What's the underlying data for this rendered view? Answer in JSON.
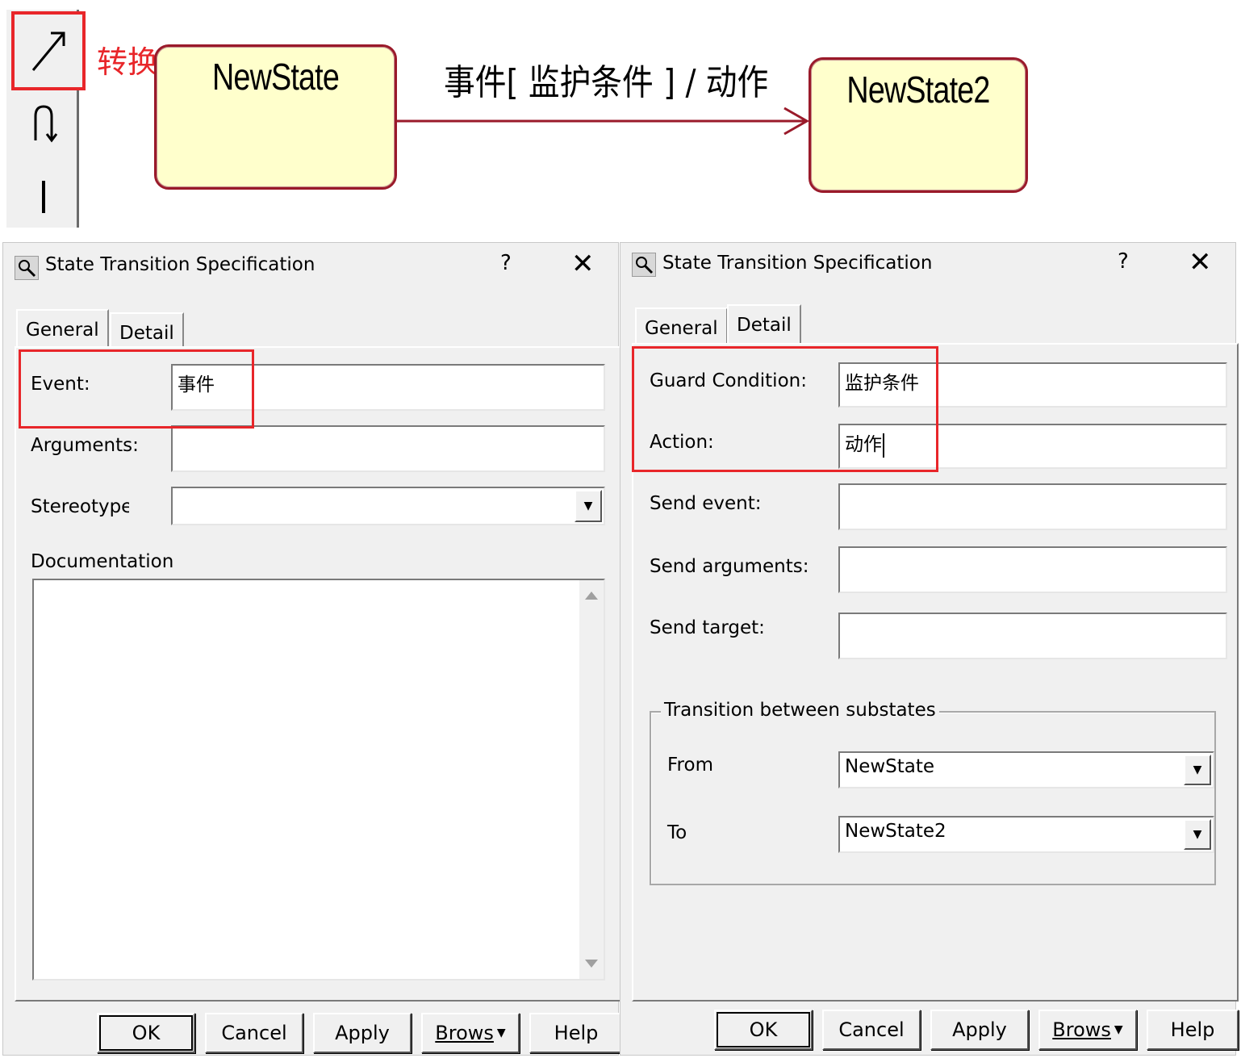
{
  "diagram": {
    "annotation_label": "转换",
    "state1": "NewState",
    "state2": "NewState2",
    "transition_label": "事件[ 监护条件 ] / 动作",
    "toolbar": {
      "tools": [
        {
          "icon": "transition-arrow-icon",
          "selected": true
        },
        {
          "icon": "self-transition-icon"
        },
        {
          "icon": "vertical-bar-icon"
        }
      ]
    }
  },
  "left_dialog": {
    "title": "State Transition Specification",
    "help": "?",
    "close": "✕",
    "tabs": [
      {
        "label": "General",
        "active": true
      },
      {
        "label": "Detail",
        "active": false
      }
    ],
    "event_label": "Event:",
    "event_value": "事件",
    "arguments_label": "Arguments:",
    "arguments_value": "",
    "stereotype_label": "Stereotype",
    "stereotype_value": "",
    "documentation_label": "Documentation",
    "documentation_value": "",
    "buttons": {
      "ok": "OK",
      "cancel": "Cancel",
      "apply": "Apply",
      "browse": "Brows",
      "help": "Help"
    }
  },
  "right_dialog": {
    "title": "State Transition Specification",
    "help": "?",
    "close": "✕",
    "tabs": [
      {
        "label": "General",
        "active": false
      },
      {
        "label": "Detail",
        "active": true
      }
    ],
    "guard_label": "Guard Condition:",
    "guard_value": "监护条件",
    "action_label": "Action:",
    "action_value": "动作",
    "send_event_label": "Send event:",
    "send_event_value": "",
    "send_arguments_label": "Send arguments:",
    "send_arguments_value": "",
    "send_target_label": "Send target:",
    "send_target_value": "",
    "substates_group": "Transition between substates",
    "from_label": "From",
    "from_value": "NewState",
    "to_label": "To",
    "to_value": "NewState2",
    "buttons": {
      "ok": "OK",
      "cancel": "Cancel",
      "apply": "Apply",
      "browse": "Brows",
      "help": "Help"
    }
  },
  "colors": {
    "highlight": "#e8262a",
    "state_fill": "#ffffcc",
    "state_border": "#9a1a2a",
    "dialog_bg": "#f0f0f0"
  }
}
